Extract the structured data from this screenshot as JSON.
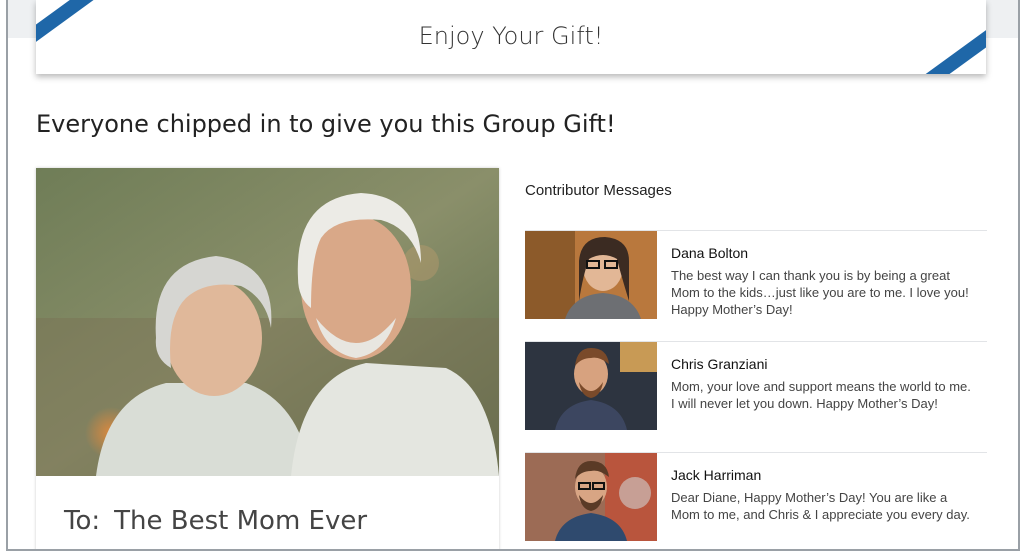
{
  "banner": {
    "title": "Enjoy Your Gift!"
  },
  "headline": "Everyone chipped in to give you this Group Gift!",
  "gift": {
    "to_label": "To:",
    "recipient": "The Best Mom Ever"
  },
  "messages": {
    "title": "Contributor Messages",
    "items": [
      {
        "name": "Dana Bolton",
        "text": "The best way I can thank you is by being a great Mom to the kids…just like you are to me. I love you! Happy Mother’s Day!"
      },
      {
        "name": "Chris Granziani",
        "text": "Mom, your love and support means the world to me. I will never let you down. Happy Mother’s Day!"
      },
      {
        "name": "Jack Harriman",
        "text": "Dear Diane, Happy Mother’s Day! You are like a Mom to me, and Chris & I appreciate you every day."
      }
    ]
  },
  "colors": {
    "ribbon": "#1f67a8",
    "accent": "#3a6ea8"
  }
}
